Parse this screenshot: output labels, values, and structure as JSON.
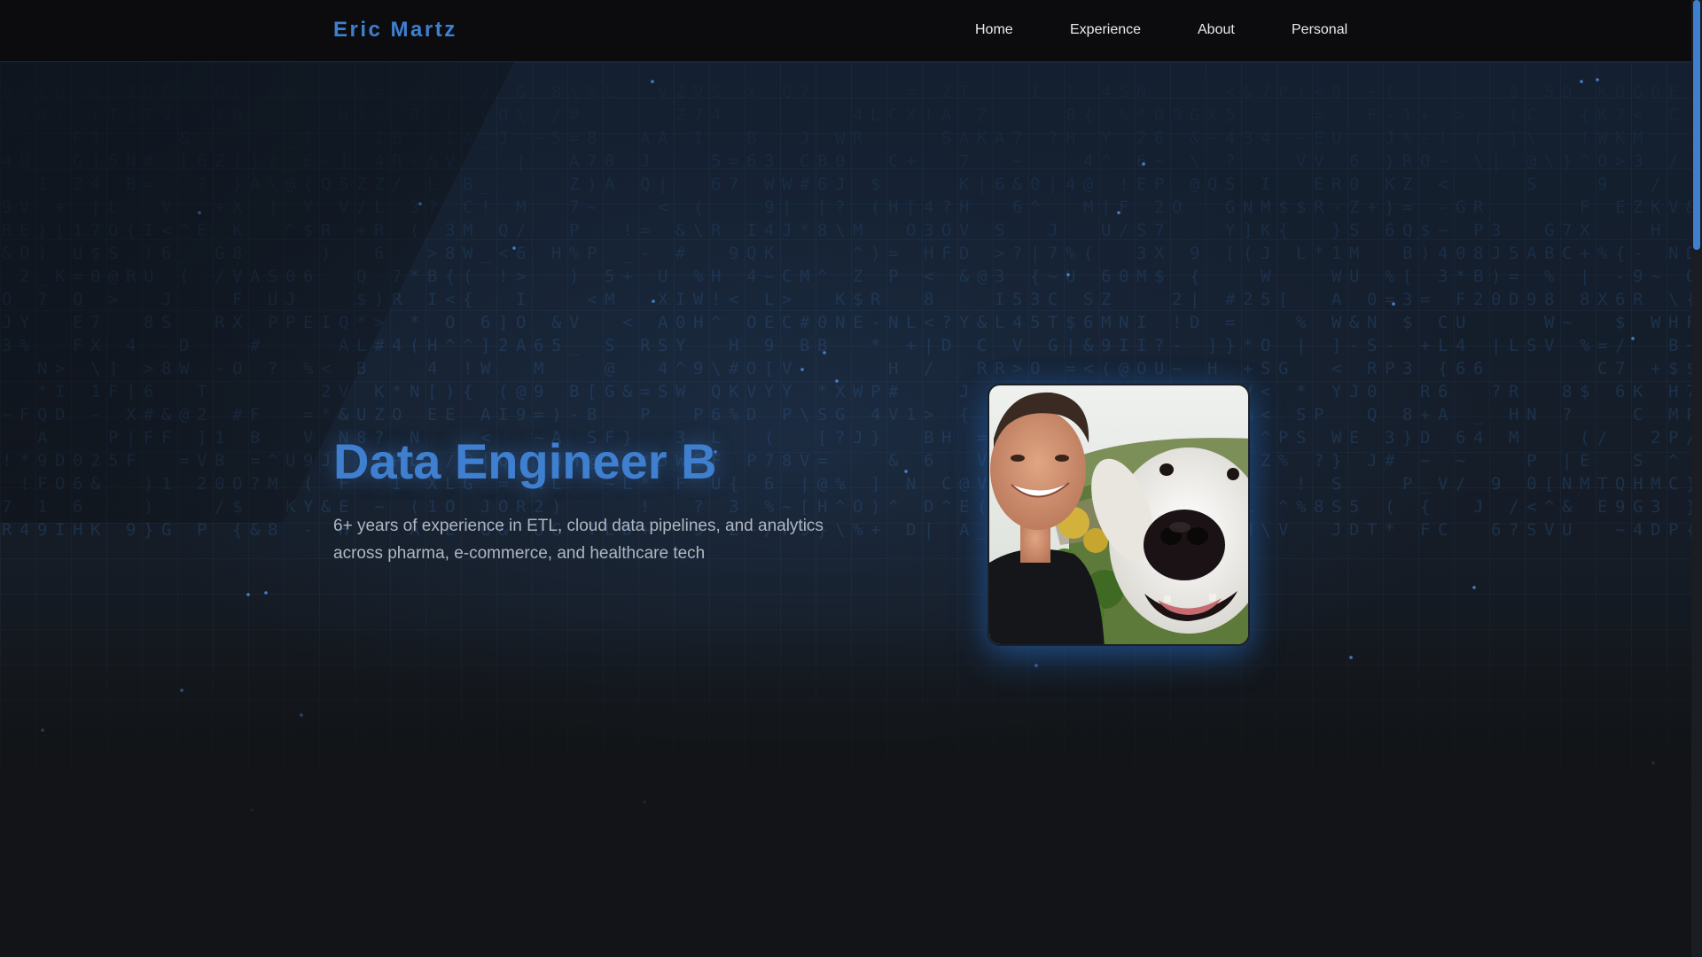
{
  "nav": {
    "brand": "Eric Martz",
    "links": [
      {
        "label": "Home"
      },
      {
        "label": "Experience"
      },
      {
        "label": "About"
      },
      {
        "label": "Personal"
      }
    ]
  },
  "hero": {
    "title": "Data Engineer B",
    "subtitle": "6+ years of experience in ETL, cloud data pipelines, and analytics across pharma, e-commerce, and healthcare tech"
  },
  "colors": {
    "accent": "#3f7fd0",
    "background": "#121417",
    "nav_background": "#0c0d0f",
    "text": "#e8eaed",
    "muted_text": "#aeb6c0"
  },
  "icons": {
    "photo": "profile-photo-with-dog"
  }
}
